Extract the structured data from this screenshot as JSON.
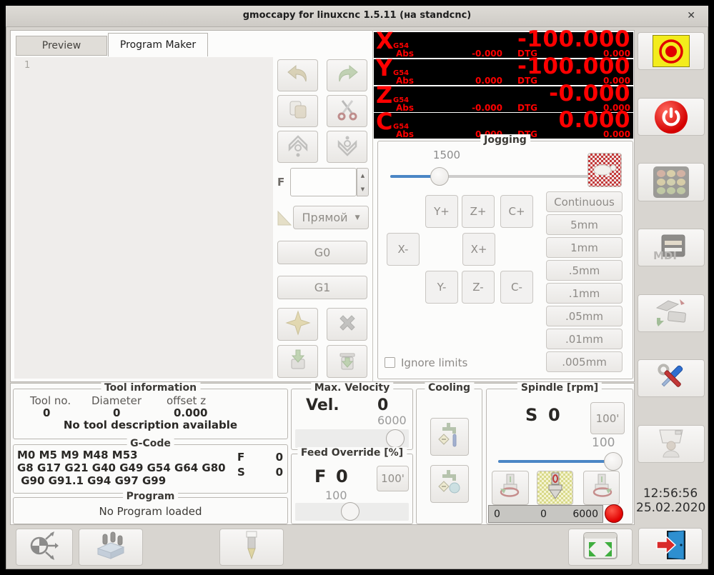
{
  "window": {
    "title": "gmoccapy for linuxcnc  1.5.11 (на standcnc)",
    "close_icon": "✕"
  },
  "tabs": {
    "preview": "Preview",
    "program_maker": "Program Maker"
  },
  "editor": {
    "line_number": "1"
  },
  "maker": {
    "f_label": "F",
    "f_value": "",
    "motion_type": "Прямой",
    "dropdown_arrow": "▼",
    "g0": "G0",
    "g1": "G1",
    "spin_up": "▲",
    "spin_down": "▼"
  },
  "dro": {
    "axes": [
      {
        "letter": "X",
        "system": "G54",
        "abs_label": "Abs",
        "abs_value": "-0.000",
        "dtg_label": "DTG",
        "dtg_value": "0.000",
        "value": "-100.000"
      },
      {
        "letter": "Y",
        "system": "G54",
        "abs_label": "Abs",
        "abs_value": "0.000",
        "dtg_label": "DTG",
        "dtg_value": "0.000",
        "value": "-100.000"
      },
      {
        "letter": "Z",
        "system": "G54",
        "abs_label": "Abs",
        "abs_value": "-0.000",
        "dtg_label": "DTG",
        "dtg_value": "0.000",
        "value": "-0.000"
      },
      {
        "letter": "C",
        "system": "G54",
        "abs_label": "Abs",
        "abs_value": "0.000",
        "dtg_label": "DTG",
        "dtg_value": "0.000",
        "value": "0.000"
      }
    ]
  },
  "jogging": {
    "title": "Jogging",
    "speed": "1500",
    "buttons": {
      "y_plus": "Y+",
      "z_plus": "Z+",
      "c_plus": "C+",
      "x_minus": "X-",
      "x_plus": "X+",
      "y_minus": "Y-",
      "z_minus": "Z-",
      "c_minus": "C-"
    },
    "increments": [
      "Continuous",
      "5mm",
      "1mm",
      ".5mm",
      ".1mm",
      ".05mm",
      ".01mm",
      ".005mm"
    ],
    "ignore_limits": "Ignore limits"
  },
  "tool_info": {
    "title": "Tool information",
    "headers": [
      "Tool no.",
      "Diameter",
      "offset z"
    ],
    "values": [
      "0",
      "0",
      "0.000"
    ],
    "description": "No tool description available"
  },
  "gcode": {
    "title": "G-Code",
    "line1": "M0 M5 M9 M48 M53",
    "line2": "G8 G17 G21 G40 G49 G54 G64 G80",
    "line3": " G90 G91.1 G94 G97 G99",
    "f_label": "F",
    "f_value": "0",
    "s_label": "S",
    "s_value": "0"
  },
  "program": {
    "title": "Program",
    "status": "No Program loaded"
  },
  "max_velocity": {
    "title": "Max. Velocity",
    "label": "Vel.",
    "value": "0",
    "max": "6000"
  },
  "feed_override": {
    "title": "Feed Override [%]",
    "label": "F",
    "value": "0",
    "reset_button": "100'",
    "current": "100"
  },
  "cooling": {
    "title": "Cooling"
  },
  "spindle": {
    "title": "Spindle [rpm]",
    "label": "S",
    "value": "0",
    "reset_button": "100'",
    "current": "100",
    "bar_min": "0",
    "bar_value": "0",
    "bar_max": "6000"
  },
  "sidebar": {
    "mdi_label": "MDI"
  },
  "clock": {
    "time": "12:56:56",
    "date": "25.02.2020"
  },
  "colors": {
    "dro_red": "#ff0000",
    "slider_blue": "#4b86c5",
    "led_red": "#e00000",
    "estop_yellow": "#f3ec1c"
  }
}
